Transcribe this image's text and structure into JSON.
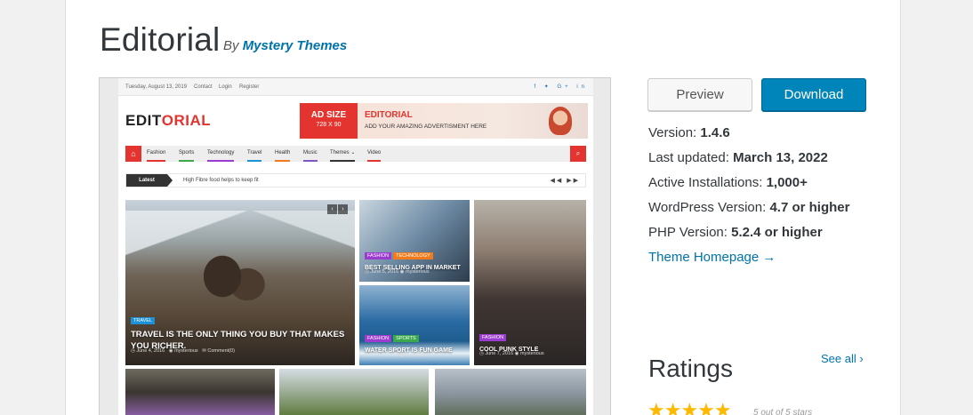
{
  "theme": {
    "title": "Editorial",
    "by_label": "By",
    "author": "Mystery Themes"
  },
  "preview": {
    "topbar": {
      "date": "Tuesday, August 13, 2019",
      "contact": "Contact",
      "login": "Login",
      "register": "Register",
      "social": "f ✦ G+ in"
    },
    "logo_a": "EDIT",
    "logo_b": "ORIAL",
    "ad": {
      "size": "AD SIZE",
      "dims": "728 X 90",
      "headline": "EDITORIAL",
      "sub": "ADD YOUR AMAZING ADVERTISMENT HERE"
    },
    "nav": [
      "Fashion",
      "Sports",
      "Technology",
      "Travel",
      "Health",
      "Music",
      "Themes ⌄",
      "Video"
    ],
    "nav_colors": [
      "#e3342f",
      "#3aa84b",
      "#9b3bd0",
      "#1e90d6",
      "#f07b1d",
      "#7e57c2",
      "#333333",
      "#e3342f"
    ],
    "ticker": {
      "label": "Latest",
      "text": "High Fibre food helps to keep fit",
      "arrows": "◀◀ ▶▶"
    },
    "big": {
      "tag": "TRAVEL",
      "title": "TRAVEL IS THE ONLY THING YOU BUY THAT MAKES YOU RICHER.",
      "date": "June 4, 2016",
      "author": "mysterious",
      "comments": "Comment(0)"
    },
    "s1": {
      "tags": [
        "FASHION",
        "TECHNOLOGY"
      ],
      "title": "BEST SELLING APP IN MARKET",
      "date": "June 5, 2016",
      "author": "mysterious"
    },
    "s3": {
      "tags": [
        "FASHION",
        "SPORTS"
      ],
      "title": "WATER SPORT IS FUN GAME",
      "date": "June 7, 2016",
      "author": "mysterious"
    },
    "s2": {
      "tags": [
        "FASHION"
      ],
      "title": "COOL PUNK STYLE",
      "date": "June 7, 2016",
      "author": "mysterious"
    },
    "tag_colors": {
      "travel": "#1e90d6",
      "fashion": "#9b3bd0",
      "technology": "#f07b1d",
      "sports": "#3aa84b"
    }
  },
  "actions": {
    "preview": "Preview",
    "download": "Download"
  },
  "details": {
    "version_label": "Version:",
    "version": "1.4.6",
    "updated_label": "Last updated:",
    "updated": "March 13, 2022",
    "installs_label": "Active Installations:",
    "installs": "1,000+",
    "wp_label": "WordPress Version:",
    "wp": "4.7 or higher",
    "php_label": "PHP Version:",
    "php": "5.2.4 or higher",
    "homepage": "Theme Homepage →"
  },
  "ratings": {
    "heading": "Ratings",
    "see_all": "See all ›",
    "stars": "★★★★★",
    "stars_text": "5 out of 5 stars",
    "value": 5
  },
  "colors": {
    "link": "#0073aa",
    "download": "#0085ba",
    "accent_red": "#e3342f",
    "star": "#ffb900"
  }
}
